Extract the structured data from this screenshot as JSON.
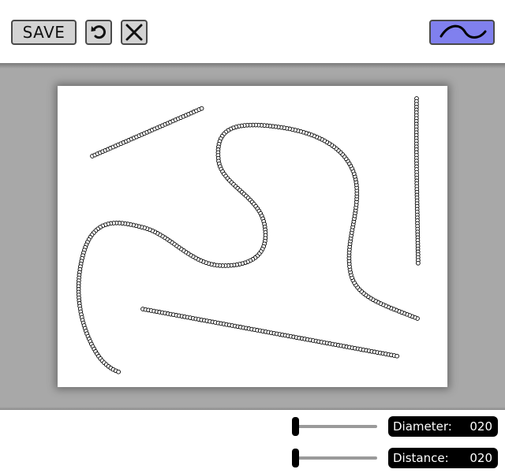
{
  "toolbar": {
    "save_label": "SAVE",
    "undo_icon": "undo-icon",
    "close_icon": "close-icon",
    "mode_icon": "wave-icon",
    "mode_color": "#8080ee"
  },
  "canvas": {
    "background": "#ffffff",
    "stroke_style": "chain of small circles"
  },
  "controls": {
    "diameter": {
      "label": "Diameter:",
      "value": "020",
      "level": 0
    },
    "distance": {
      "label": "Distance:",
      "value": "020",
      "level": 0
    }
  }
}
